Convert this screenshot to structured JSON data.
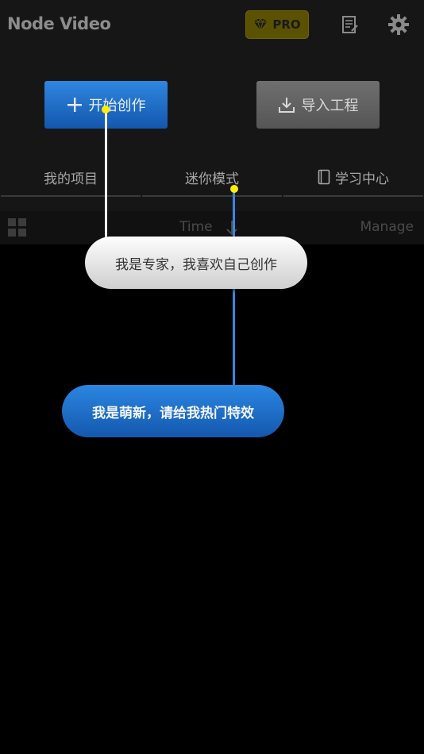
{
  "header": {
    "app_title": "Node Video",
    "pro_label": "PRO"
  },
  "actions": {
    "create_label": "开始创作",
    "import_label": "导入工程"
  },
  "tabs": [
    {
      "label": "我的项目"
    },
    {
      "label": "迷你模式"
    },
    {
      "label": "学习中心"
    }
  ],
  "sortbar": {
    "sort_label": "Time",
    "manage_label": "Manage"
  },
  "onboarding": {
    "expert_option": "我是专家，我喜欢自己创作",
    "newbie_option": "我是萌新，请给我热门特效"
  },
  "colors": {
    "accent_blue": "#1f6fcc",
    "highlight_dot": "#ffee00",
    "pro_badge": "#5a5200"
  }
}
